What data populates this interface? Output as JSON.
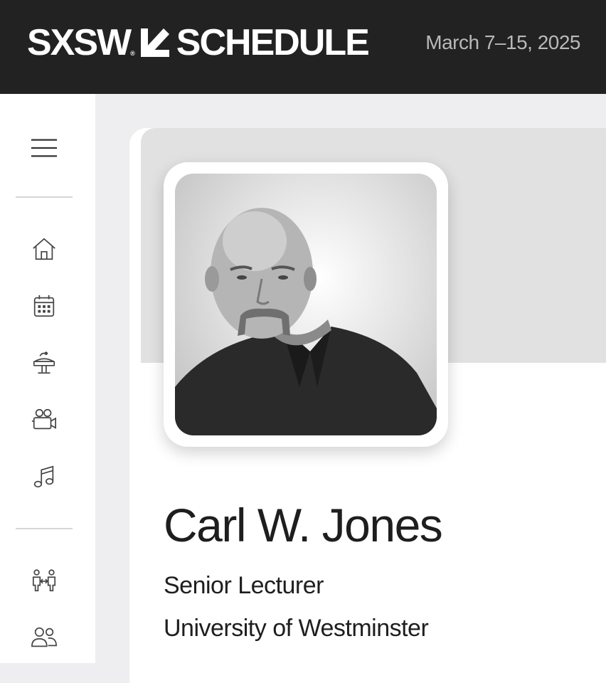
{
  "header": {
    "brand": "SXSW",
    "brand_mark": "®",
    "section": "SCHEDULE",
    "dates": "March 7–15, 2025"
  },
  "sidebar": {
    "items": [
      {
        "name": "menu",
        "icon": "hamburger-menu-icon"
      },
      {
        "name": "home",
        "icon": "home-icon"
      },
      {
        "name": "calendar",
        "icon": "calendar-icon"
      },
      {
        "name": "conference",
        "icon": "podium-icon"
      },
      {
        "name": "film",
        "icon": "film-camera-icon"
      },
      {
        "name": "music",
        "icon": "music-note-icon"
      },
      {
        "name": "networking",
        "icon": "people-exchange-icon"
      },
      {
        "name": "people",
        "icon": "people-icon"
      }
    ]
  },
  "profile": {
    "name": "Carl W. Jones",
    "title": "Senior Lecturer",
    "organization": "University of Westminster"
  },
  "colors": {
    "header_bg": "#222222",
    "page_bg": "#eeeef0",
    "banner_bg": "#e1e1e1",
    "text": "#1e1e1e",
    "dates_text": "#b9b9b9"
  }
}
